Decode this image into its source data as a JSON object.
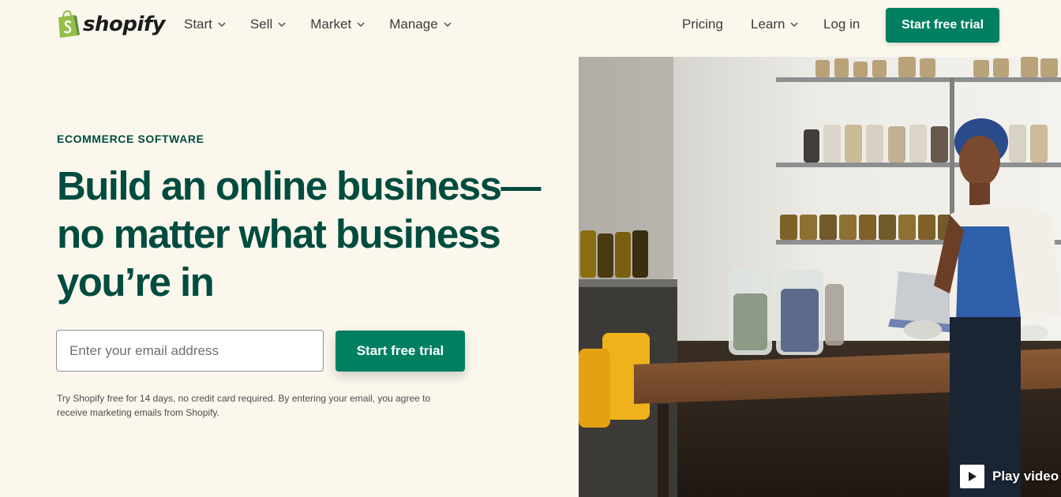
{
  "brand": {
    "name": "shopify",
    "logo_icon": "shopping-bag-icon",
    "color": "#95bf47"
  },
  "nav": {
    "left": [
      {
        "label": "Start",
        "icon": "chevron-down-icon"
      },
      {
        "label": "Sell",
        "icon": "chevron-down-icon"
      },
      {
        "label": "Market",
        "icon": "chevron-down-icon"
      },
      {
        "label": "Manage",
        "icon": "chevron-down-icon"
      }
    ],
    "pricing_label": "Pricing",
    "learn_label": "Learn",
    "login_label": "Log in",
    "cta_label": "Start free trial"
  },
  "hero": {
    "eyebrow": "ECOMMERCE SOFTWARE",
    "headline": "Build an online business—no matter what business you’re in",
    "email_placeholder": "Enter your email address",
    "cta_label": "Start free trial",
    "disclaimer": "Try Shopify free for 14 days, no credit card required. By entering your email, you agree to receive marketing emails from Shopify.",
    "play_label": "Play video",
    "play_icon": "play-icon"
  },
  "colors": {
    "accent": "#008060",
    "heading": "#004c3f",
    "background": "#fbf7ed"
  }
}
